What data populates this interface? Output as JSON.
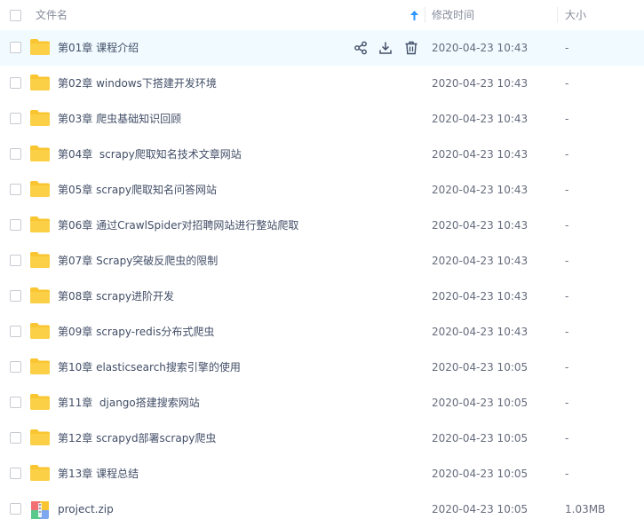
{
  "header": {
    "name_label": "文件名",
    "date_label": "修改时间",
    "size_label": "大小",
    "sort_icon": "sort-up-arrow-icon",
    "sort_color": "#2c96ff"
  },
  "colors": {
    "folder": "#f9c632",
    "hover_row": "#f0faff",
    "text": "#424e67"
  },
  "hover_actions": [
    "share-icon",
    "download-icon",
    "delete-icon"
  ],
  "files": [
    {
      "name": "第01章 课程介绍",
      "date": "2020-04-23 10:43",
      "size": "-"
    },
    {
      "name": "第02章 windows下搭建开发环境",
      "date": "2020-04-23 10:43",
      "size": "-"
    },
    {
      "name": "第03章 爬虫基础知识回顾",
      "date": "2020-04-23 10:43",
      "size": "-"
    },
    {
      "name": "第04章  scrapy爬取知名技术文章网站",
      "date": "2020-04-23 10:43",
      "size": "-"
    },
    {
      "name": "第05章 scrapy爬取知名问答网站",
      "date": "2020-04-23 10:43",
      "size": "-"
    },
    {
      "name": "第06章 通过CrawlSpider对招聘网站进行整站爬取",
      "date": "2020-04-23 10:43",
      "size": "-"
    },
    {
      "name": "第07章 Scrapy突破反爬虫的限制",
      "date": "2020-04-23 10:43",
      "size": "-"
    },
    {
      "name": "第08章 scrapy进阶开发",
      "date": "2020-04-23 10:43",
      "size": "-"
    },
    {
      "name": "第09章 scrapy-redis分布式爬虫",
      "date": "2020-04-23 10:43",
      "size": "-"
    },
    {
      "name": "第10章 elasticsearch搜索引擎的使用",
      "date": "2020-04-23 10:05",
      "size": "-"
    },
    {
      "name": "第11章  django搭建搜索网站",
      "date": "2020-04-23 10:05",
      "size": "-"
    },
    {
      "name": "第12章 scrapyd部署scrapy爬虫",
      "date": "2020-04-23 10:05",
      "size": "-"
    },
    {
      "name": "第13章 课程总结",
      "date": "2020-04-23 10:05",
      "size": "-"
    },
    {
      "name": "project.zip",
      "date": "2020-04-23 10:05",
      "size": "1.03MB"
    }
  ]
}
